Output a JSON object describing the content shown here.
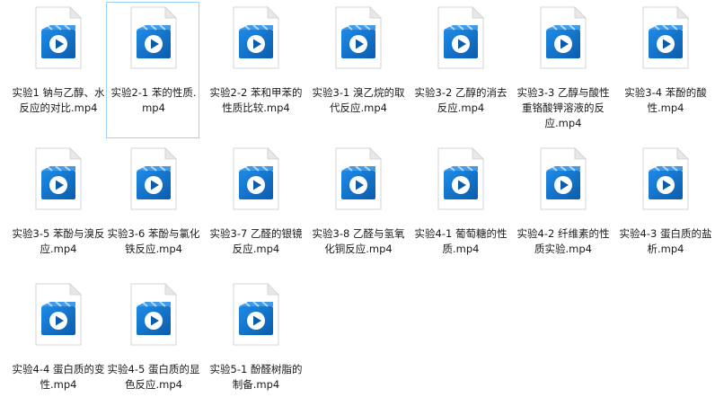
{
  "colors": {
    "page_fold": "#e8e8e8",
    "page": "#ffffff",
    "icon_dark": "#0b5cab",
    "icon_light": "#1e8be8",
    "selection_border": "#99d1ff"
  },
  "icon_name": "video-file-icon",
  "files": [
    {
      "name": "实验1 钠与乙醇、水反应的对比.mp4"
    },
    {
      "name": "实验2-1 苯的性质.mp4",
      "selected": true
    },
    {
      "name": "实验2-2 苯和甲苯的性质比较.mp4"
    },
    {
      "name": "实验3-1 溴乙烷的取代反应.mp4"
    },
    {
      "name": "实验3-2 乙醇的消去反应.mp4"
    },
    {
      "name": "实验3-3 乙醇与酸性重铬酸钾溶液的反应.mp4"
    },
    {
      "name": "实验3-4 苯酚的酸性.mp4"
    },
    {
      "name": "实验3-5 苯酚与溴反应.mp4"
    },
    {
      "name": "实验3-6 苯酚与氯化铁反应.mp4"
    },
    {
      "name": "实验3-7 乙醛的银镜反应.mp4"
    },
    {
      "name": "实验3-8 乙醛与氢氧化铜反应.mp4"
    },
    {
      "name": "实验4-1 葡萄糖的性质.mp4"
    },
    {
      "name": "实验4-2 纤维素的性质实验.mp4"
    },
    {
      "name": "实验4-3 蛋白质的盐析.mp4"
    },
    {
      "name": "实验4-4 蛋白质的变性.mp4"
    },
    {
      "name": "实验4-5 蛋白质的显色反应.mp4"
    },
    {
      "name": "实验5-1 酚醛树脂的制备.mp4"
    }
  ]
}
